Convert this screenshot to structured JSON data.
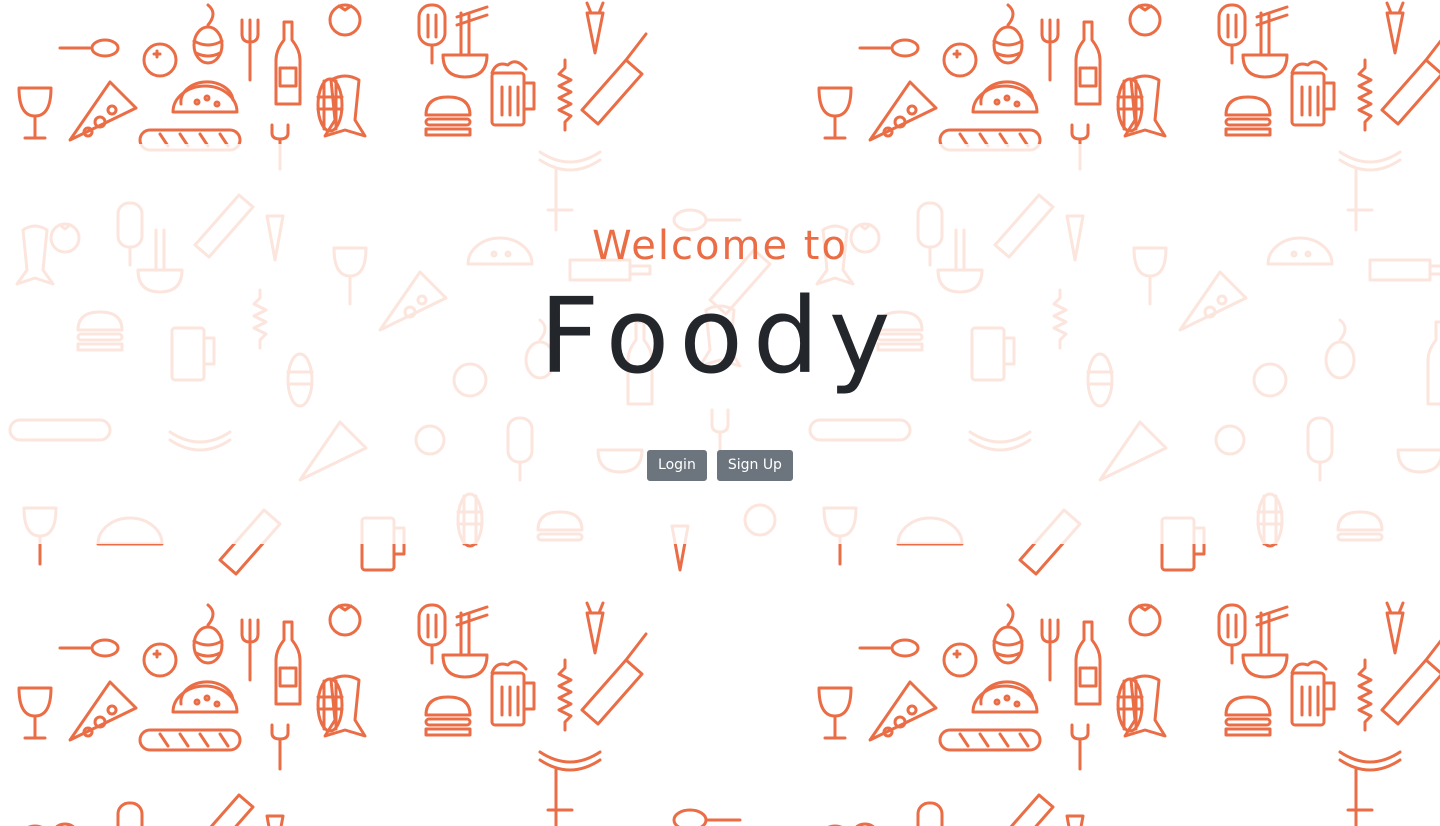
{
  "hero": {
    "welcome_text": "Welcome to",
    "brand_name": "Foody"
  },
  "actions": {
    "login_label": "Login",
    "signup_label": "Sign Up"
  },
  "background": {
    "pattern": "food-doodle-pattern",
    "pattern_color": "#ea6d45",
    "overlay_color": "#ffffff",
    "icons": [
      "tomato-icon",
      "spoon-icon",
      "orange-icon",
      "hops-icon",
      "fork-icon",
      "bottle-icon",
      "popsicle-icon",
      "noodle-bowl-icon",
      "beer-mug-icon",
      "knife-icon",
      "carrot-icon",
      "wine-glass-icon",
      "pizza-slice-icon",
      "taco-icon",
      "corn-icon",
      "fish-icon",
      "burger-icon",
      "baguette-icon",
      "sausage-icon",
      "corkscrew-icon"
    ]
  },
  "colors": {
    "accent": "#ea6d45",
    "brand_text": "#23272b",
    "button_bg": "#6c757d",
    "button_text": "#ffffff"
  }
}
